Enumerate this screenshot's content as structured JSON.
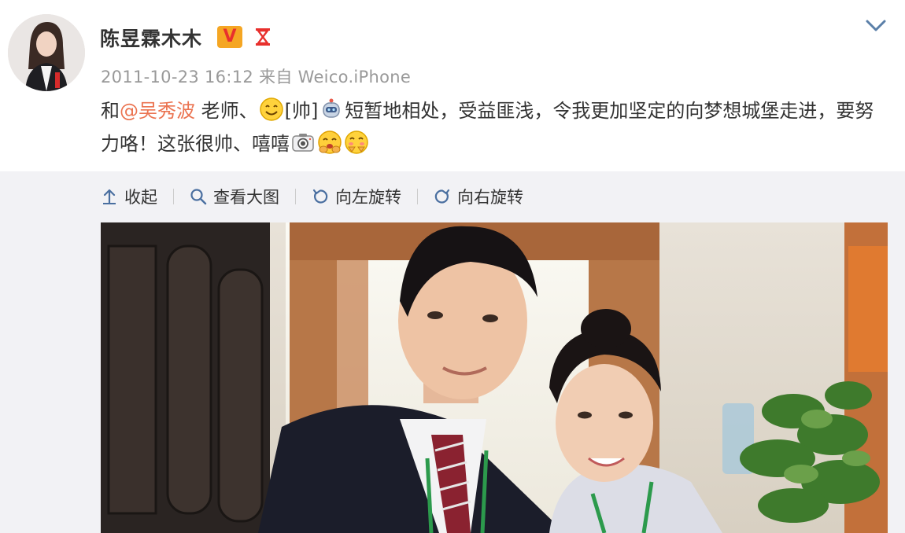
{
  "post": {
    "username": "陈昱霖木木",
    "badge_v": "V",
    "timestamp": "2011-10-23 16:12",
    "source_prefix": "来自",
    "source": "Weico.iPhone",
    "text": {
      "part1": "和",
      "mention": "@吴秀波",
      "part2": " 老师、",
      "emoticon_tag": "[帅]",
      "part3": "短暂地相处，受益匪浅，令我更加坚定的向梦想城堡走进，要努力咯！这张很帅、嘻嘻"
    }
  },
  "toolbar": {
    "collapse_label": "收起",
    "view_large_label": "查看大图",
    "rotate_left_label": "向左旋转",
    "rotate_right_label": "向右旋转"
  },
  "colors": {
    "mention": "#eb7350",
    "meta": "#999999",
    "panel_bg": "#f2f2f5",
    "badge_bg": "#f5a623",
    "badge_fg": "#e8302d"
  },
  "icons": {
    "expand": "chevron-down-icon",
    "collapse": "arrow-up-icon",
    "view_large": "magnifier-icon",
    "rotate_left": "rotate-left-icon",
    "rotate_right": "rotate-right-icon"
  }
}
